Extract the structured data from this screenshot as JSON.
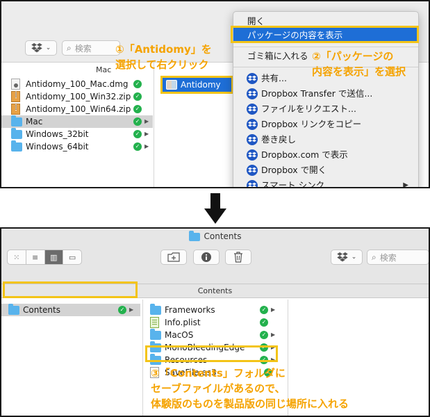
{
  "top": {
    "search_placeholder": "検索",
    "column_header": "Mac",
    "files": [
      {
        "name": "Antidomy_100_Mac.dmg",
        "icon": "dmg-icon"
      },
      {
        "name": "Antidomy_100_Win32.zip",
        "icon": "zip-icon"
      },
      {
        "name": "Antidomy_100_Win64.zip",
        "icon": "zip-icon"
      },
      {
        "name": "Mac",
        "icon": "folder-icon"
      },
      {
        "name": "Windows_32bit",
        "icon": "folder-icon"
      },
      {
        "name": "Windows_64bit",
        "icon": "folder-icon"
      }
    ],
    "selected_app": "Antidomy",
    "context_menu": {
      "open": "開く",
      "show_package_contents": "パッケージの内容を表示",
      "move_to_trash": "ゴミ箱に入れる",
      "share": "共有...",
      "dropbox_transfer": "Dropbox Transfer で送信...",
      "request_files": "ファイルをリクエスト...",
      "copy_dropbox_link": "Dropbox リンクをコピー",
      "rewind": "巻き戻し",
      "view_on_dropbox": "Dropbox.com で表示",
      "open_in_dropbox": "Dropbox で開く",
      "smart_sync": "スマート シンク"
    }
  },
  "callouts": {
    "step1_line1": "①「Antidomy」を",
    "step1_line2": "選択して右クリック",
    "step2_line1": "②「パッケージの",
    "step2_line2": "内容を表示」を選択",
    "step3_line1": "③「Contents」フォルダに",
    "step3_line2": "セーブファイルがあるので、",
    "step3_line3": "体験版のものを製品版の同じ場所に入れる"
  },
  "bottom": {
    "window_title": "Contents",
    "search_placeholder": "検索",
    "path_label": "Contents",
    "left_item": "Contents",
    "items": [
      {
        "name": "Frameworks",
        "icon": "folder-icon",
        "has_chevron": true
      },
      {
        "name": "Info.plist",
        "icon": "plist-icon",
        "has_chevron": false
      },
      {
        "name": "MacOS",
        "icon": "folder-icon",
        "has_chevron": true
      },
      {
        "name": "MonoBleedingEdge",
        "icon": "folder-icon",
        "has_chevron": true
      },
      {
        "name": "Resources",
        "icon": "folder-icon",
        "has_chevron": true
      },
      {
        "name": "SaveFile.es3",
        "icon": "document-icon",
        "has_chevron": false
      }
    ]
  },
  "colors": {
    "accent_blue": "#1e6ed6",
    "callout_yellow": "#f3c417",
    "callout_text": "#f5a300",
    "sync_green": "#23b14d",
    "folder_blue": "#58b3ec"
  }
}
